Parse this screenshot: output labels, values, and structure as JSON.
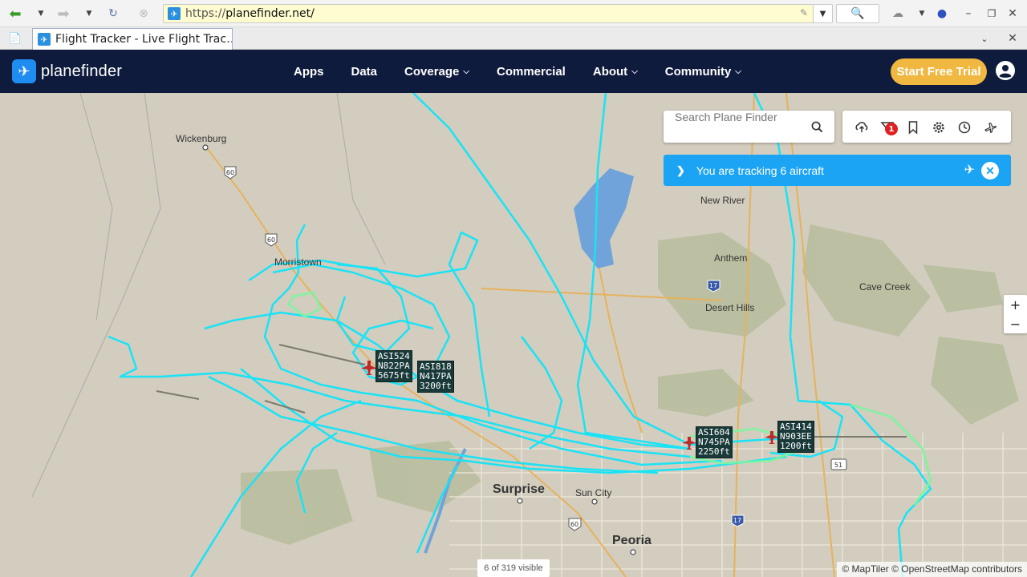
{
  "browser": {
    "url_scheme": "https://",
    "url_host": "planefinder.net/",
    "tab_title": "Flight Tracker - Live Flight Trac…"
  },
  "site": {
    "logo_text": "planefinder",
    "nav": [
      {
        "label": "Apps",
        "has_menu": false
      },
      {
        "label": "Data",
        "has_menu": false
      },
      {
        "label": "Coverage",
        "has_menu": true
      },
      {
        "label": "Commercial",
        "has_menu": false
      },
      {
        "label": "About",
        "has_menu": true
      },
      {
        "label": "Community",
        "has_menu": true
      }
    ],
    "trial_label": "Start Free Trial",
    "colors": {
      "navbar": "#0f1b3d",
      "trial": "#f0b840",
      "accent": "#1ca4f4",
      "track": "#19e3f5"
    }
  },
  "search": {
    "placeholder": "Search Plane Finder"
  },
  "tools": {
    "icons": [
      "cloud-upload-icon",
      "filter-icon",
      "bookmark-icon",
      "settings-icon",
      "history-icon",
      "airport-icon"
    ],
    "filter_badge": "1"
  },
  "tracking": {
    "text": "You are tracking 6 aircraft"
  },
  "zoom": {
    "in": "+",
    "out": "−"
  },
  "status": {
    "visible_count": "6 of 319 visible"
  },
  "attribution": "© MapTiler © OpenStreetMap contributors",
  "places": {
    "wickenburg": "Wickenburg",
    "morristown": "Morristown",
    "new_river": "New River",
    "anthem": "Anthem",
    "cave_creek": "Cave Creek",
    "desert_hills": "Desert Hills",
    "surprise": "Surprise",
    "sun_city": "Sun City",
    "peoria": "Peoria"
  },
  "aircraft": [
    {
      "callsign": "ASI524",
      "reg": "N822PA",
      "alt": "5675ft"
    },
    {
      "callsign": "ASI818",
      "reg": "N417PA",
      "alt": "3200ft"
    },
    {
      "callsign": "ASI604",
      "reg": "N745PA",
      "alt": "2250ft"
    },
    {
      "callsign": "ASI414",
      "reg": "N903EE",
      "alt": "1200ft"
    }
  ]
}
